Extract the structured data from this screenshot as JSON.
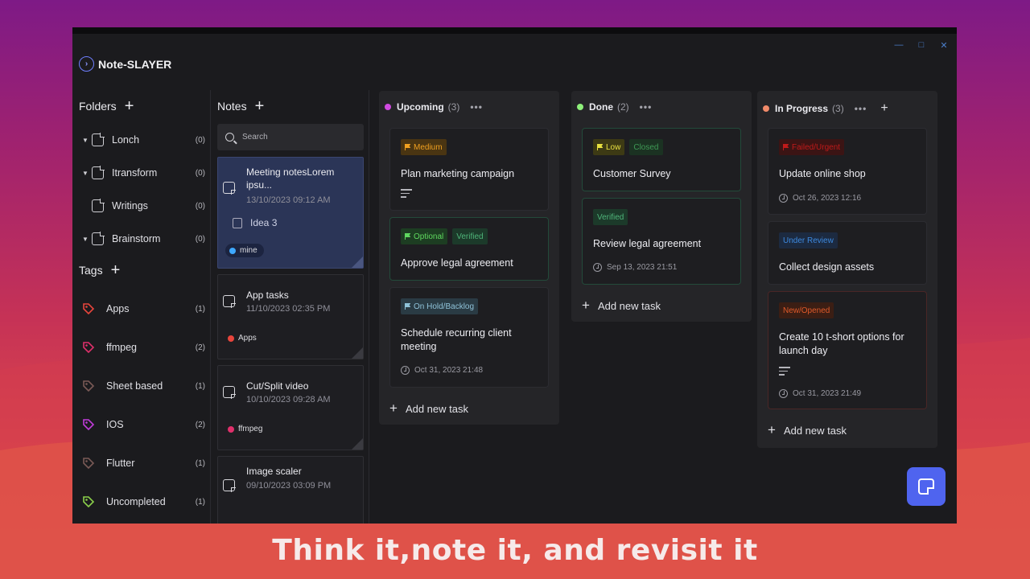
{
  "app": {
    "title": "Note-SLAYER",
    "window_controls": [
      "—",
      "□",
      "✕"
    ]
  },
  "folders": {
    "header": "Folders",
    "add": "+",
    "items": [
      {
        "name": "Lonch",
        "count": "(0)",
        "expandable": true
      },
      {
        "name": "Itransform",
        "count": "(0)",
        "expandable": true
      },
      {
        "name": "Writings",
        "count": "(0)",
        "expandable": false
      },
      {
        "name": "Brainstorm",
        "count": "(0)",
        "expandable": true
      }
    ]
  },
  "tags": {
    "header": "Tags",
    "add": "+",
    "items": [
      {
        "name": "Apps",
        "count": "(1)",
        "color": "#e8453c"
      },
      {
        "name": "ffmpeg",
        "count": "(2)",
        "color": "#e0306b"
      },
      {
        "name": "Sheet based",
        "count": "(1)",
        "color": "#7a5a56"
      },
      {
        "name": "IOS",
        "count": "(2)",
        "color": "#c23cdb"
      },
      {
        "name": "Flutter",
        "count": "(1)",
        "color": "#7a5a56"
      },
      {
        "name": "Uncompleted",
        "count": "(1)",
        "color": "#8bd04a"
      }
    ]
  },
  "notes": {
    "header": "Notes",
    "add": "+",
    "search_placeholder": "Search",
    "items": [
      {
        "title": "Meeting notesLorem ipsu...",
        "date": "13/10/2023 09:12 AM",
        "sub": "Idea 3",
        "tag": "mine",
        "tag_color": "#3ea8ff"
      },
      {
        "title": "App tasks",
        "date": "11/10/2023 02:35 PM",
        "tag": "Apps",
        "tag_color": "#e8453c"
      },
      {
        "title": "Cut/Split video",
        "date": "10/10/2023 09:28 AM",
        "tag": "ffmpeg",
        "tag_color": "#e0306b"
      },
      {
        "title": "Image scaler",
        "date": "09/10/2023 03:09 PM"
      }
    ]
  },
  "lanes": [
    {
      "name": "Upcoming",
      "count": "(3)",
      "color": "#d04ae0",
      "more": "•••",
      "cards": [
        {
          "badges": [
            {
              "label": "Medium",
              "flag": true,
              "fg": "#f0a020",
              "bg": "#4a3512"
            }
          ],
          "title": "Plan marketing campaign",
          "desc": true
        },
        {
          "badges": [
            {
              "label": "Optional",
              "flag": true,
              "fg": "#5fd85f",
              "bg": "#1d3d22"
            },
            {
              "label": "Verified",
              "flag": false,
              "fg": "#4fb57a",
              "bg": "#1c3a2a"
            }
          ],
          "title": "Approve legal agreement"
        },
        {
          "badges": [
            {
              "label": "On Hold/Backlog",
              "flag": true,
              "fg": "#8fc2d8",
              "bg": "#2a3b44"
            }
          ],
          "title": "Schedule recurring client meeting",
          "date": "Oct 31, 2023 21:48"
        }
      ],
      "add": "Add new task"
    },
    {
      "name": "Done",
      "count": "(2)",
      "color": "#8ef07a",
      "more": "•••",
      "cards": [
        {
          "badges": [
            {
              "label": "Low",
              "flag": true,
              "fg": "#e8e040",
              "bg": "#3d3a14"
            },
            {
              "label": "Closed",
              "flag": false,
              "fg": "#3f9a55",
              "bg": "#1b3222"
            }
          ],
          "title": "Customer Survey"
        },
        {
          "badges": [
            {
              "label": "Verified",
              "flag": false,
              "fg": "#4fb57a",
              "bg": "#1c3a2a"
            }
          ],
          "title": "Review legal agreement",
          "date": "Sep 13, 2023 21:51"
        }
      ],
      "add": "Add new task"
    },
    {
      "name": "In Progress",
      "count": "(3)",
      "color": "#f08a6a",
      "more": "•••",
      "plus": "+",
      "cards": [
        {
          "badges": [
            {
              "label": "Failed/Urgent",
              "flag": true,
              "fg": "#c01a1a",
              "bg": "#3b1414"
            }
          ],
          "title": "Update online shop",
          "date": "Oct 26, 2023 12:16"
        },
        {
          "badges": [
            {
              "label": "Under Review",
              "flag": false,
              "fg": "#3d8ae0",
              "bg": "#1c2a40"
            }
          ],
          "title": "Collect design assets"
        },
        {
          "badges": [
            {
              "label": "New/Opened",
              "flag": false,
              "fg": "#e05a2a",
              "bg": "#3b1e14"
            }
          ],
          "title": "Create 10 t-short options for launch day",
          "desc": true,
          "date": "Oct 31, 2023 21:49"
        }
      ],
      "add": "Add new task"
    }
  ],
  "caption": "Think it,note it, and revisit it"
}
